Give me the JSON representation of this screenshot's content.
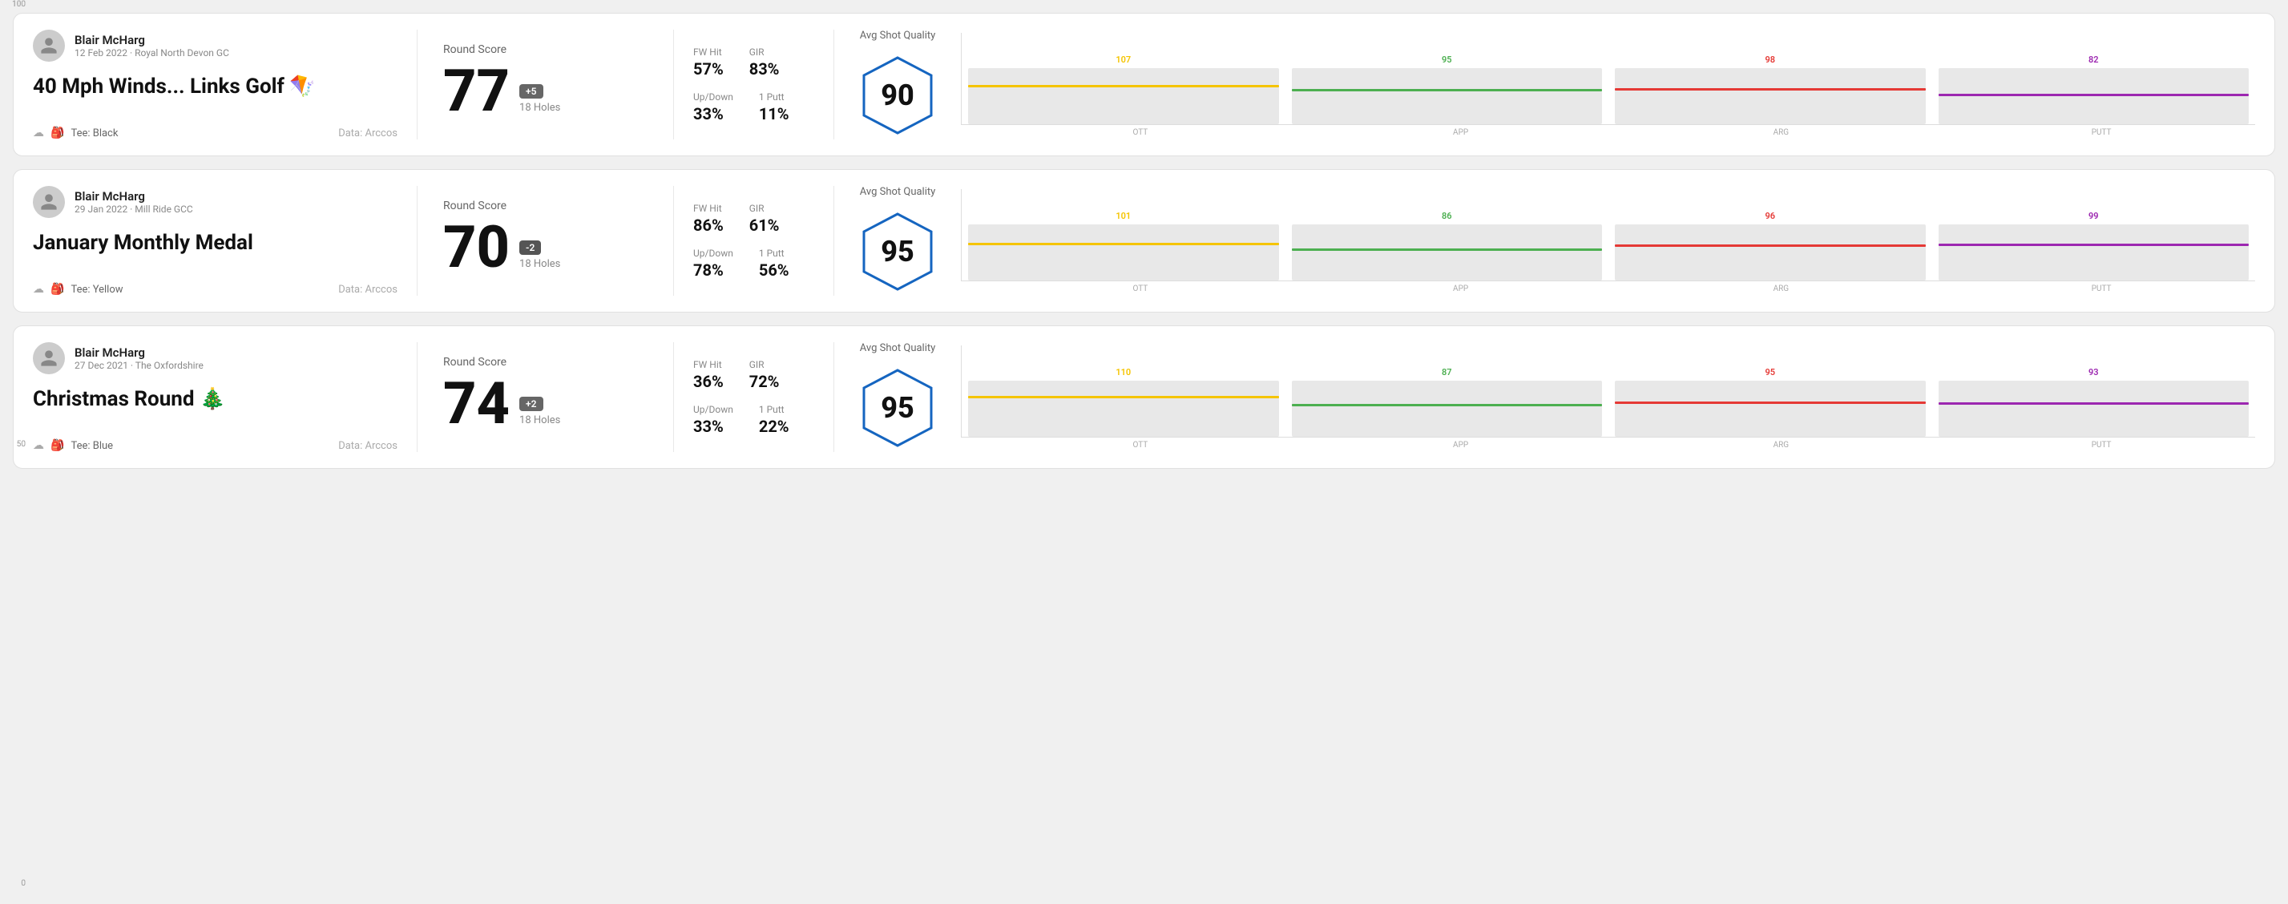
{
  "rounds": [
    {
      "id": "round1",
      "user": {
        "name": "Blair McHarg",
        "meta": "12 Feb 2022 · Royal North Devon GC"
      },
      "title": "40 Mph Winds... Links Golf 🪁",
      "tee": "Black",
      "data_source": "Data: Arccos",
      "round_score_label": "Round Score",
      "score": "77",
      "badge": "+5",
      "badge_type": "over",
      "holes": "18 Holes",
      "fw_hit_label": "FW Hit",
      "fw_hit": "57%",
      "gir_label": "GIR",
      "gir": "83%",
      "updown_label": "Up/Down",
      "updown": "33%",
      "oneputt_label": "1 Putt",
      "oneputt": "11%",
      "avg_shot_quality_label": "Avg Shot Quality",
      "quality_score": "90",
      "chart": {
        "y_labels": [
          "100",
          "50",
          "0"
        ],
        "bars": [
          {
            "label": "OTT",
            "value": 107,
            "color": "#f5c400",
            "bar_pct": 65
          },
          {
            "label": "APP",
            "value": 95,
            "color": "#4caf50",
            "bar_pct": 58
          },
          {
            "label": "ARG",
            "value": 98,
            "color": "#e53935",
            "bar_pct": 60
          },
          {
            "label": "PUTT",
            "value": 82,
            "color": "#9c27b0",
            "bar_pct": 50
          }
        ]
      }
    },
    {
      "id": "round2",
      "user": {
        "name": "Blair McHarg",
        "meta": "29 Jan 2022 · Mill Ride GCC"
      },
      "title": "January Monthly Medal",
      "tee": "Yellow",
      "data_source": "Data: Arccos",
      "round_score_label": "Round Score",
      "score": "70",
      "badge": "-2",
      "badge_type": "under",
      "holes": "18 Holes",
      "fw_hit_label": "FW Hit",
      "fw_hit": "86%",
      "gir_label": "GIR",
      "gir": "61%",
      "updown_label": "Up/Down",
      "updown": "78%",
      "oneputt_label": "1 Putt",
      "oneputt": "56%",
      "avg_shot_quality_label": "Avg Shot Quality",
      "quality_score": "95",
      "chart": {
        "y_labels": [
          "100",
          "50",
          "0"
        ],
        "bars": [
          {
            "label": "OTT",
            "value": 101,
            "color": "#f5c400",
            "bar_pct": 62
          },
          {
            "label": "APP",
            "value": 86,
            "color": "#4caf50",
            "bar_pct": 52
          },
          {
            "label": "ARG",
            "value": 96,
            "color": "#e53935",
            "bar_pct": 59
          },
          {
            "label": "PUTT",
            "value": 99,
            "color": "#9c27b0",
            "bar_pct": 61
          }
        ]
      }
    },
    {
      "id": "round3",
      "user": {
        "name": "Blair McHarg",
        "meta": "27 Dec 2021 · The Oxfordshire"
      },
      "title": "Christmas Round 🎄",
      "tee": "Blue",
      "data_source": "Data: Arccos",
      "round_score_label": "Round Score",
      "score": "74",
      "badge": "+2",
      "badge_type": "over",
      "holes": "18 Holes",
      "fw_hit_label": "FW Hit",
      "fw_hit": "36%",
      "gir_label": "GIR",
      "gir": "72%",
      "updown_label": "Up/Down",
      "updown": "33%",
      "oneputt_label": "1 Putt",
      "oneputt": "22%",
      "avg_shot_quality_label": "Avg Shot Quality",
      "quality_score": "95",
      "chart": {
        "y_labels": [
          "100",
          "50",
          "0"
        ],
        "bars": [
          {
            "label": "OTT",
            "value": 110,
            "color": "#f5c400",
            "bar_pct": 68
          },
          {
            "label": "APP",
            "value": 87,
            "color": "#4caf50",
            "bar_pct": 53
          },
          {
            "label": "ARG",
            "value": 95,
            "color": "#e53935",
            "bar_pct": 58
          },
          {
            "label": "PUTT",
            "value": 93,
            "color": "#9c27b0",
            "bar_pct": 57
          }
        ]
      }
    }
  ]
}
